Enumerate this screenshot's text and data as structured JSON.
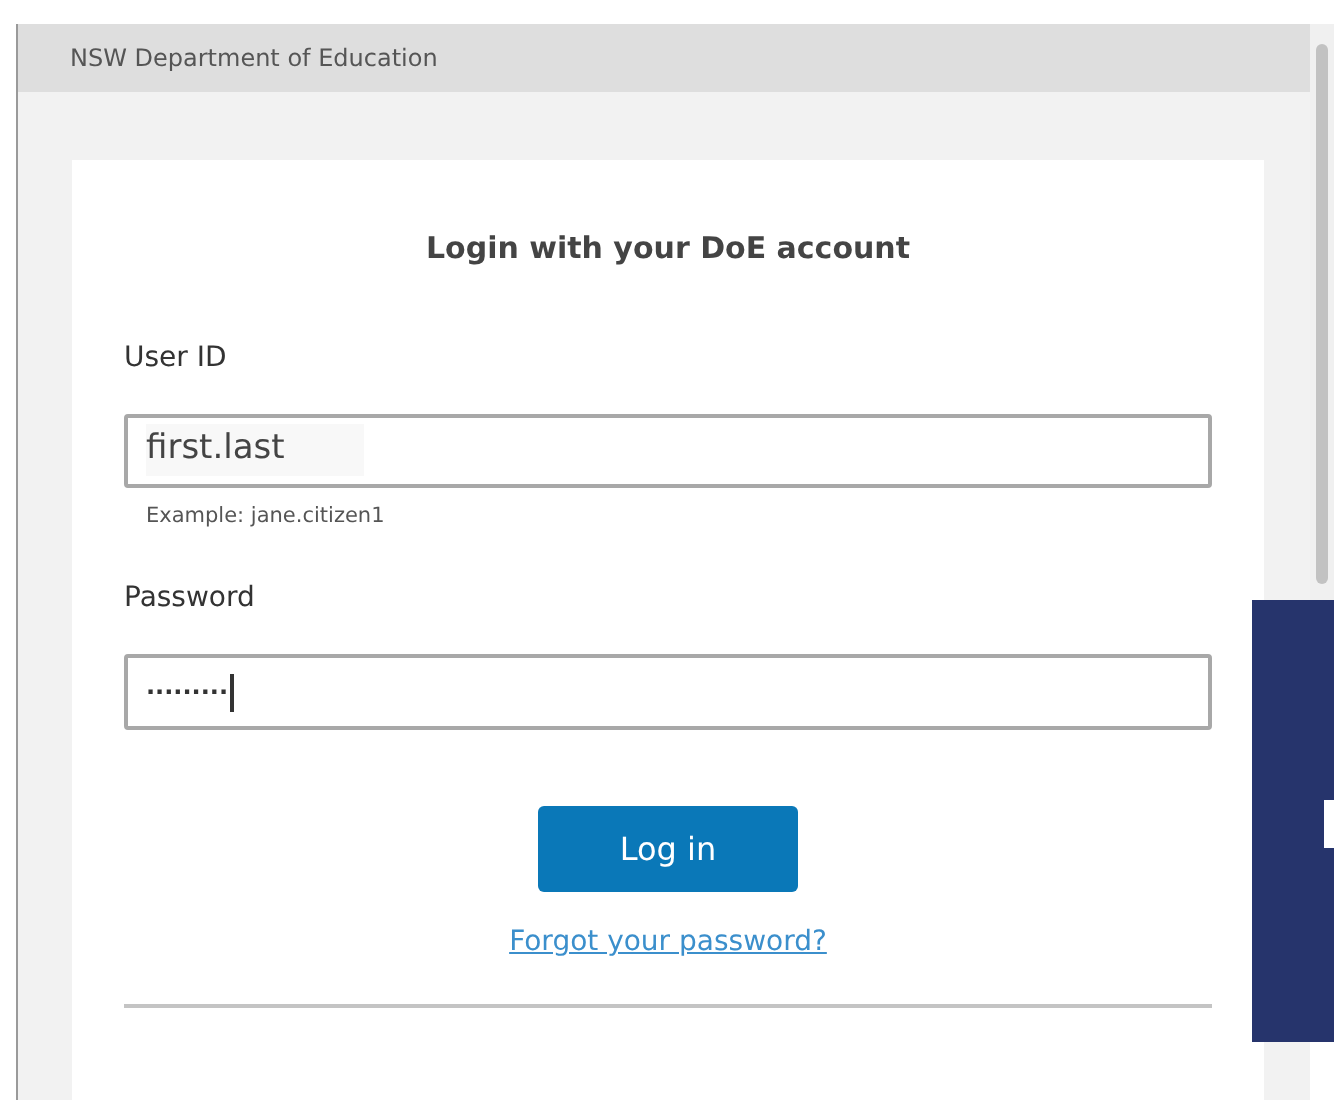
{
  "window": {
    "title": "NSW Department of Education"
  },
  "form": {
    "heading": "Login with your DoE account",
    "user_id": {
      "label": "User ID",
      "value": "first.last",
      "hint": "Example: jane.citizen1"
    },
    "password": {
      "label": "Password",
      "value": ".........",
      "focused": true
    },
    "login_button": "Log in",
    "forgot_link": "Forgot your password?"
  }
}
